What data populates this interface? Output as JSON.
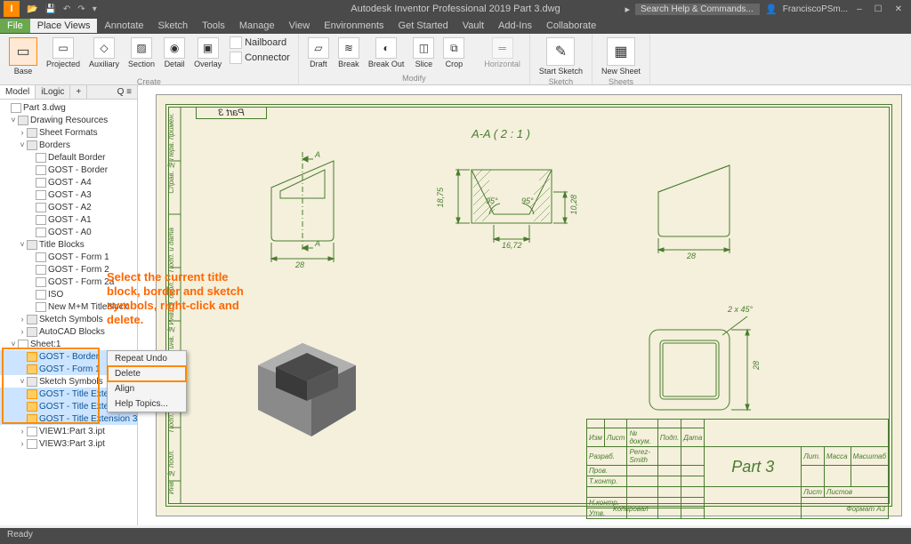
{
  "app": {
    "title": "Autodesk Inventor Professional 2019  Part 3.dwg",
    "user": "FranciscoPSm...",
    "search_placeholder": "Search Help & Commands..."
  },
  "menu_tabs": [
    "File",
    "Place Views",
    "Annotate",
    "Sketch",
    "Tools",
    "Manage",
    "View",
    "Environments",
    "Get Started",
    "Vault",
    "Add-Ins",
    "Collaborate"
  ],
  "ribbon": {
    "create": {
      "name": "Create",
      "buttons": [
        "Base",
        "Projected",
        "Auxiliary",
        "Section",
        "Detail",
        "Overlay"
      ],
      "side": [
        "Nailboard",
        "Connector"
      ]
    },
    "modify": {
      "name": "Modify",
      "buttons": [
        "Draft",
        "Break",
        "Break Out",
        "Slice",
        "Crop",
        "Horizontal"
      ]
    },
    "sketch": {
      "name": "Sketch",
      "button": "Start Sketch"
    },
    "sheets": {
      "name": "Sheets",
      "button": "New Sheet"
    }
  },
  "browser": {
    "tabs": [
      "Model",
      "iLogic"
    ],
    "root": "Part 3.dwg",
    "drawing_resources": "Drawing Resources",
    "sheet_formats": "Sheet Formats",
    "borders_folder": "Borders",
    "borders": [
      "Default Border",
      "GOST - Border",
      "GOST - A4",
      "GOST - A3",
      "GOST - A2",
      "GOST - A1",
      "GOST - A0"
    ],
    "titleblocks_folder": "Title Blocks",
    "titleblocks": [
      "GOST - Form 1",
      "GOST - Form 2",
      "GOST - Form 2a",
      "ISO",
      "New M+M Titleblock"
    ],
    "sketch_symbols": "Sketch Symbols",
    "autocad_blocks": "AutoCAD Blocks",
    "sheet1": "Sheet:1",
    "sheet_items": {
      "border": "GOST - Border",
      "form": "GOST - Form 1",
      "sym_folder": "Sketch Symbols",
      "syms": [
        "GOST - Title Extension 1",
        "GOST - Title Extension 2",
        "GOST - Title Extension 3"
      ]
    },
    "views": [
      "VIEW1:Part 3.ipt",
      "VIEW3:Part 3.ipt"
    ]
  },
  "context_menu": [
    "Repeat Undo",
    "Delete",
    "Align",
    "Help Topics..."
  ],
  "annotation_text": "Select the current title block, border and sketch symbols, right-click and delete.",
  "drawing": {
    "part_label": "Part 3",
    "section_label": "A-A ( 2 : 1 )",
    "section_mark": "A",
    "dim_28": "28",
    "dim_1672": "16,72",
    "dim_1875": "18,75",
    "dim_1028": "10,28",
    "ang95": "95°",
    "chamfer": "2 x 45°",
    "titleblock": {
      "part": "Part 3",
      "headers": [
        "Изм",
        "Лист",
        "№ докум.",
        "Подп.",
        "Дата"
      ],
      "rows": [
        "Разраб.",
        "Пров.",
        "Т.контр.",
        "Н.контр.",
        "Утв."
      ],
      "designer": "Perez-Smith",
      "cols": [
        "Лит.",
        "Масса",
        "Масштаб"
      ],
      "sheet_cols": [
        "Лист",
        "Листов"
      ],
      "format": "Формат А3",
      "copied": "Копировал"
    },
    "side_labels": [
      "Инв. № подл.",
      "Подп. и дата",
      "Взам. инв. №",
      "Инв. № дубл.",
      "Подп. и дата",
      "Справ. №",
      "Перв. примен."
    ]
  },
  "status": "Ready"
}
